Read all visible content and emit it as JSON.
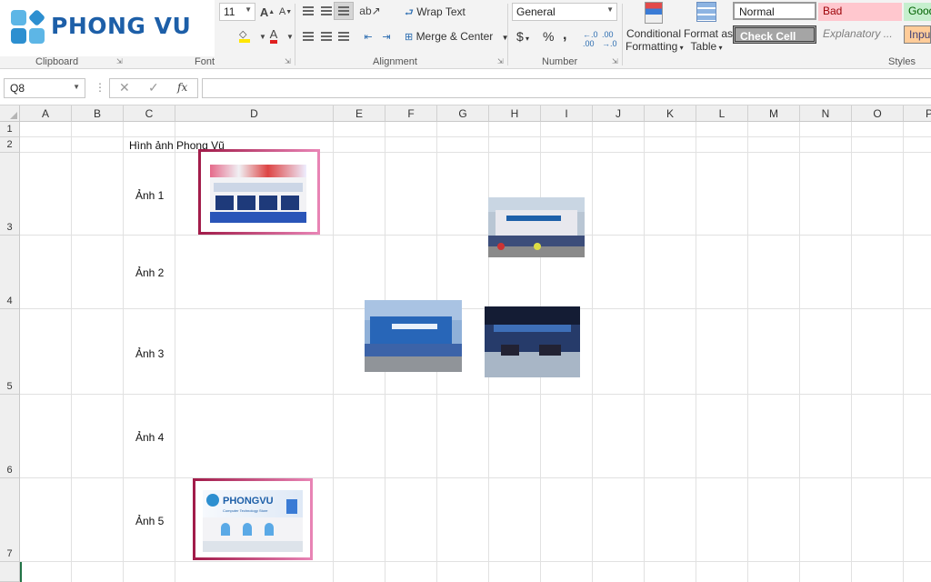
{
  "logo": {
    "text": "PHONG VU"
  },
  "ribbon": {
    "font_size": "11",
    "font_grow": "A",
    "font_shrink": "A",
    "wrap_text": "Wrap Text",
    "merge_center": "Merge & Center",
    "number_format": "General",
    "currency": "$",
    "percent": "%",
    "comma": ",",
    "conditional_formatting": [
      "Conditional",
      "Formatting"
    ],
    "format_as_table": [
      "Format as",
      "Table"
    ],
    "groups": {
      "clipboard": "Clipboard",
      "font": "Font",
      "alignment": "Alignment",
      "number": "Number",
      "styles": "Styles"
    },
    "styles": {
      "normal": "Normal",
      "bad": "Bad",
      "good": "Good",
      "check_cell": "Check Cell",
      "explanatory": "Explanatory ...",
      "input": "Input"
    }
  },
  "formula_bar": {
    "name_box": "Q8",
    "fx": "fx",
    "value": ""
  },
  "columns": [
    "A",
    "B",
    "C",
    "D",
    "E",
    "F",
    "G",
    "H",
    "I",
    "J",
    "K",
    "L",
    "M",
    "N",
    "O",
    "P"
  ],
  "rows": [
    "1",
    "2",
    "3",
    "4",
    "5",
    "6",
    "7"
  ],
  "cells": {
    "C2": "Hình ảnh Phong Vũ",
    "C3": "Ảnh 1",
    "C4": "Ảnh 2",
    "C5": "Ảnh 3",
    "C6": "Ảnh 4",
    "C7": "Ảnh 5"
  },
  "photos": {
    "photo1_sign": "",
    "photo5_sign": "PHONGVU",
    "photo5_sub": "Computer Technology Store"
  },
  "colors": {
    "accent_frame_start": "#a21c4a",
    "accent_frame_end": "#e884b5",
    "brand_blue": "#1d5fa8",
    "bad_bg": "#ffc7ce",
    "good_bg": "#c6efce",
    "input_bg": "#ffcc99",
    "check_cell_bg": "#a5a5a5"
  }
}
